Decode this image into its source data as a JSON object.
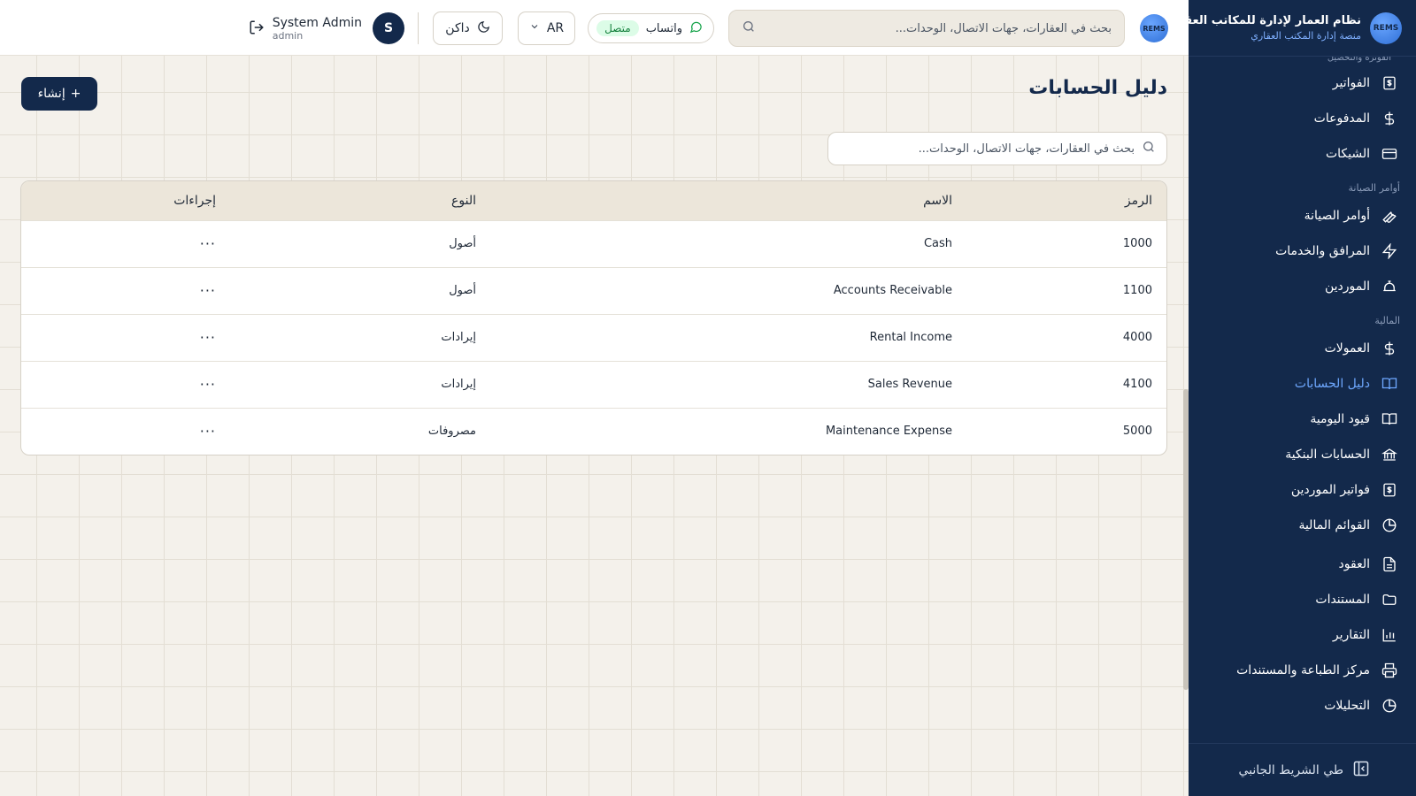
{
  "brand": {
    "logo_text": "REMS",
    "name": "نظام العمار لإدارة للمكاتب العقارية",
    "subtitle": "منصة إدارة المكتب العقاري"
  },
  "sidebar": {
    "cut_section": "الفوترة والتحصيل",
    "sections": [
      {
        "title": "",
        "items": [
          {
            "label": "الفواتير",
            "icon": "invoice-icon"
          },
          {
            "label": "المدفوعات",
            "icon": "dollar-icon"
          },
          {
            "label": "الشيكات",
            "icon": "credit-card-icon"
          }
        ]
      },
      {
        "title": "أوامر الصيانة",
        "items": [
          {
            "label": "أوامر الصيانة",
            "icon": "wrench-icon"
          },
          {
            "label": "المرافق والخدمات",
            "icon": "bolt-icon"
          },
          {
            "label": "الموردين",
            "icon": "truck-icon"
          }
        ]
      },
      {
        "title": "المالية",
        "items": [
          {
            "label": "العمولات",
            "icon": "dollar-icon"
          },
          {
            "label": "دليل الحسابات",
            "icon": "book-icon",
            "active": true
          },
          {
            "label": "قيود اليومية",
            "icon": "book-icon"
          },
          {
            "label": "الحسابات البنكية",
            "icon": "bank-icon"
          },
          {
            "label": "فواتير الموردين",
            "icon": "invoice-icon"
          },
          {
            "label": "القوائم المالية",
            "icon": "pie-chart-icon"
          }
        ]
      },
      {
        "title": "",
        "items": [
          {
            "label": "العقود",
            "icon": "document-icon"
          },
          {
            "label": "المستندات",
            "icon": "folder-icon"
          },
          {
            "label": "التقارير",
            "icon": "bar-chart-icon"
          },
          {
            "label": "مركز الطباعة والمستندات",
            "icon": "printer-icon"
          },
          {
            "label": "التحليلات",
            "icon": "pie-chart-icon"
          }
        ]
      }
    ],
    "collapse_label": "طي الشريط الجانبي"
  },
  "header": {
    "logo_text": "REMS",
    "search_placeholder": "بحث في العقارات، جهات الاتصال، الوحدات...",
    "whatsapp_label": "واتساب",
    "whatsapp_status": "متصل",
    "language": "AR",
    "theme_label": "داكن",
    "user_name": "System Admin",
    "user_role": "admin",
    "avatar_initial": "S"
  },
  "page": {
    "title": "دليل الحسابات",
    "create_label": "إنشاء",
    "search_placeholder": "بحث في العقارات، جهات الاتصال، الوحدات..."
  },
  "table": {
    "headers": {
      "code": "الرمز",
      "name": "الاسم",
      "type": "النوع",
      "actions": "إجراءات"
    },
    "rows": [
      {
        "code": "1000",
        "name": "Cash",
        "type": "أصول",
        "actions": "···"
      },
      {
        "code": "1100",
        "name": "Accounts Receivable",
        "type": "أصول",
        "actions": "···"
      },
      {
        "code": "4000",
        "name": "Rental Income",
        "type": "إيرادات",
        "actions": "···"
      },
      {
        "code": "4100",
        "name": "Sales Revenue",
        "type": "إيرادات",
        "actions": "···"
      },
      {
        "code": "5000",
        "name": "Maintenance Expense",
        "type": "مصروفات",
        "actions": "···"
      }
    ]
  },
  "colors": {
    "sidebar_bg": "#13294b",
    "accent": "#6ea8ff",
    "primary_button": "#13294b",
    "status_green": "#15803d"
  }
}
